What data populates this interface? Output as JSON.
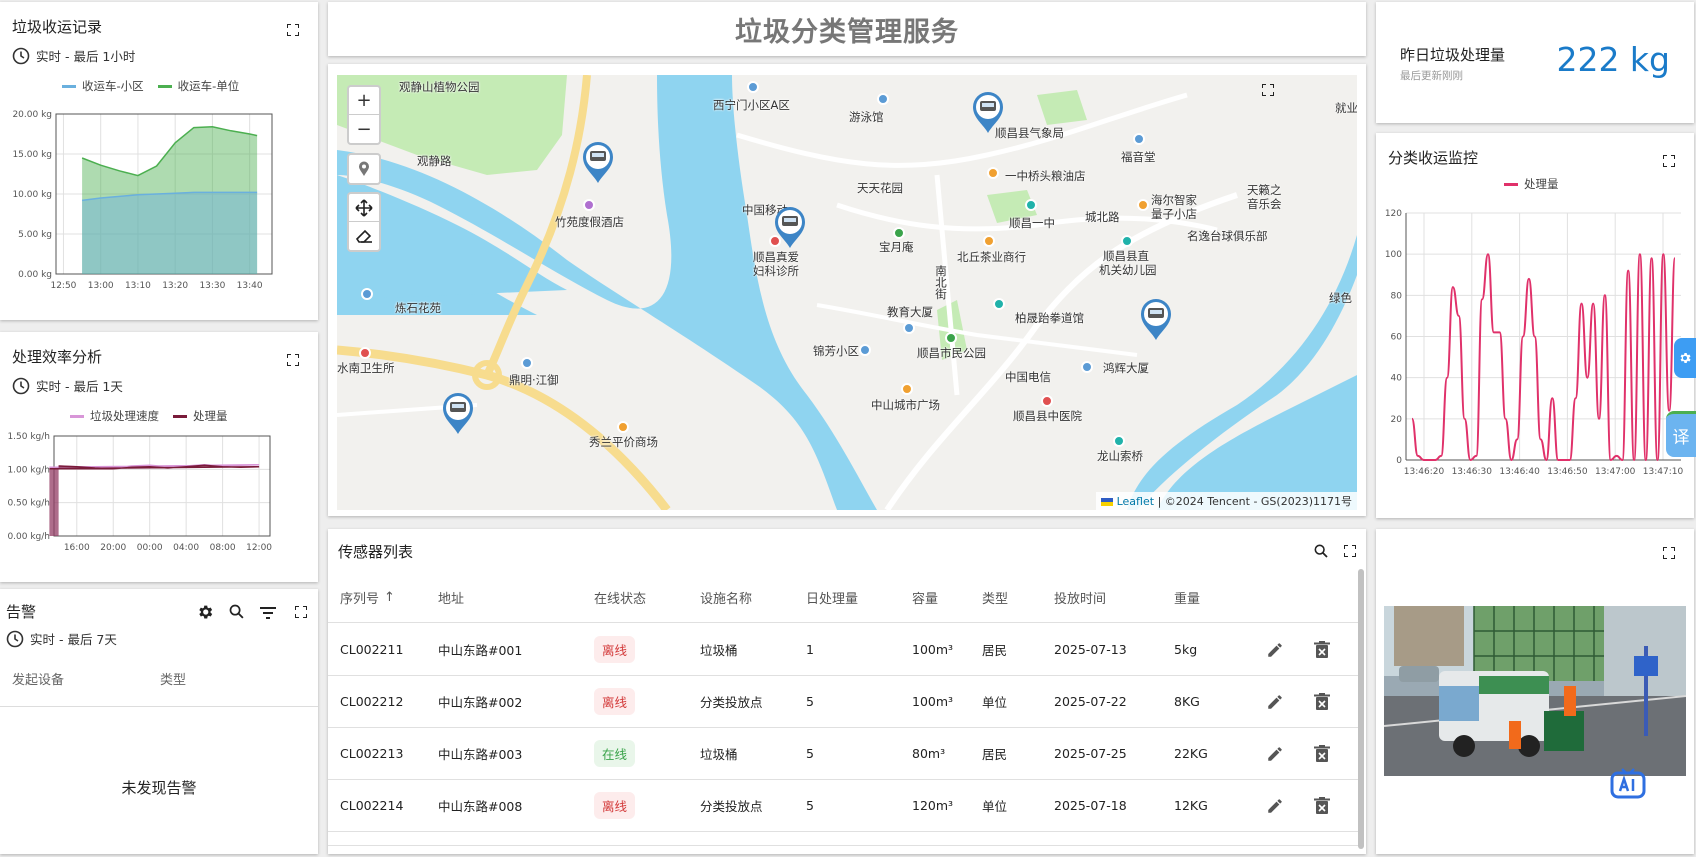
{
  "header": {
    "title": "垃圾分类管理服务"
  },
  "collection": {
    "title": "垃圾收运记录",
    "subtitle": "实时 - 最后 1小时",
    "chart_data": {
      "type": "area",
      "series": [
        {
          "name": "收运车-小区",
          "color": "#6ab0de",
          "x": [
            "12:55",
            "13:00",
            "13:05",
            "13:10",
            "13:15",
            "13:20",
            "13:25",
            "13:30",
            "13:35",
            "13:40",
            "13:42"
          ],
          "values": [
            9.2,
            9.5,
            9.7,
            9.9,
            10.0,
            10.1,
            10.2,
            10.2,
            10.2,
            10.2,
            10.2
          ]
        },
        {
          "name": "收运车-单位",
          "color": "#4caf50",
          "x": [
            "12:55",
            "13:00",
            "13:05",
            "13:10",
            "13:15",
            "13:20",
            "13:25",
            "13:30",
            "13:35",
            "13:40",
            "13:42"
          ],
          "values": [
            14.5,
            13.6,
            12.9,
            12.3,
            13.5,
            16.4,
            18.3,
            18.4,
            17.9,
            17.5,
            17.3
          ]
        }
      ],
      "x_ticks": [
        "12:50",
        "13:00",
        "13:10",
        "13:20",
        "13:30",
        "13:40"
      ],
      "y_ticks": [
        "0.00 kg",
        "5.00 kg",
        "10.00 kg",
        "15.00 kg",
        "20.00 kg"
      ],
      "ylim": [
        0,
        20
      ]
    }
  },
  "efficiency": {
    "title": "处理效率分析",
    "subtitle": "实时 - 最后 1天",
    "chart_data": {
      "type": "area",
      "series": [
        {
          "name": "垃圾处理速度",
          "color": "#d896d8",
          "x": [
            "14:00",
            "16:00",
            "18:00",
            "20:00",
            "22:00",
            "00:00",
            "02:00",
            "04:00",
            "06:00",
            "08:00",
            "10:00",
            "12:00",
            "13:00"
          ],
          "values": [
            1.05,
            1.04,
            1.03,
            1.02,
            1.05,
            1.06,
            1.04,
            1.05,
            1.07,
            1.05,
            1.06,
            1.07,
            1.03
          ]
        },
        {
          "name": "处理量",
          "color": "#7a1b3a",
          "x": [
            "14:00",
            "16:00",
            "18:00",
            "20:00",
            "22:00",
            "00:00",
            "02:00",
            "04:00",
            "06:00",
            "08:00",
            "10:00",
            "12:00",
            "13:00"
          ],
          "values": [
            1.05,
            1.04,
            1.02,
            1.01,
            1.03,
            1.04,
            1.02,
            1.04,
            1.06,
            1.04,
            1.03,
            1.04,
            1.01
          ]
        }
      ],
      "x_ticks": [
        "16:00",
        "20:00",
        "00:00",
        "04:00",
        "08:00",
        "12:00"
      ],
      "y_ticks": [
        "0.00 kg/h",
        "0.50 kg/h",
        "1.00 kg/h",
        "1.50 kg/h"
      ],
      "ylim": [
        0,
        1.5
      ]
    }
  },
  "alerts": {
    "title": "告警",
    "subtitle": "实时 - 最后 7天",
    "columns": [
      "发起设备",
      "类型"
    ],
    "empty": "未发现告警"
  },
  "map": {
    "attribution_leaflet": "Leaflet",
    "attribution_rest": "| ©2024 Tencent - GS(2023)1171号",
    "labels": [
      {
        "text": "观静山植物公园"
      },
      {
        "text": "西宁门小区A区"
      },
      {
        "text": "游泳馆"
      },
      {
        "text": "顺昌县气象局"
      },
      {
        "text": "福音堂"
      },
      {
        "text": "观静路"
      },
      {
        "text": "一中桥头粮油店"
      },
      {
        "text": "天天花园"
      },
      {
        "text": "竹苑度假酒店"
      },
      {
        "text": "中国移动"
      },
      {
        "text": "顺昌一中"
      },
      {
        "text": "城北路"
      },
      {
        "text": "海尔智家"
      },
      {
        "text": "量子小店"
      },
      {
        "text": "天籁之"
      },
      {
        "text": "音乐会"
      },
      {
        "text": "名逸台球俱乐部"
      },
      {
        "text": "宝月庵"
      },
      {
        "text": "顺昌真爱"
      },
      {
        "text": "妇科诊所"
      },
      {
        "text": "北丘茶业商行"
      },
      {
        "text": "顺昌县直"
      },
      {
        "text": "机关幼儿园"
      },
      {
        "text": "炼石花苑"
      },
      {
        "text": "教育大厦"
      },
      {
        "text": "柏晟跆拳道馆"
      },
      {
        "text": "南北街"
      },
      {
        "text": "锦芳小区"
      },
      {
        "text": "顺昌市民公园"
      },
      {
        "text": "水南卫生所"
      },
      {
        "text": "鼎明·江御"
      },
      {
        "text": "中国电信"
      },
      {
        "text": "鸿辉大厦"
      },
      {
        "text": "中山城市广场"
      },
      {
        "text": "顺昌县中医院"
      },
      {
        "text": "秀兰平价商场"
      },
      {
        "text": "龙山索桥"
      },
      {
        "text": "绿色"
      },
      {
        "text": "就业"
      }
    ]
  },
  "sensors": {
    "title": "传感器列表",
    "columns": [
      "序列号",
      "地址",
      "在线状态",
      "设施名称",
      "日处理量",
      "容量",
      "类型",
      "投放时间",
      "重量"
    ],
    "rows": [
      {
        "id": "CL002211",
        "addr": "中山东路#001",
        "status": "离线",
        "status_kind": "off",
        "name": "垃圾桶",
        "daily": "1",
        "cap": "100m³",
        "type": "居民",
        "date": "2025-07-13",
        "weight": "5kg"
      },
      {
        "id": "CL002212",
        "addr": "中山东路#002",
        "status": "离线",
        "status_kind": "off",
        "name": "分类投放点",
        "daily": "5",
        "cap": "100m³",
        "type": "单位",
        "date": "2025-07-22",
        "weight": "8KG"
      },
      {
        "id": "CL002213",
        "addr": "中山东路#003",
        "status": "在线",
        "status_kind": "on",
        "name": "垃圾桶",
        "daily": "5",
        "cap": "80m³",
        "type": "居民",
        "date": "2025-07-25",
        "weight": "22KG"
      },
      {
        "id": "CL002214",
        "addr": "中山东路#008",
        "status": "离线",
        "status_kind": "off",
        "name": "分类投放点",
        "daily": "5",
        "cap": "120m³",
        "type": "单位",
        "date": "2025-07-18",
        "weight": "12KG"
      }
    ]
  },
  "stat": {
    "label": "昨日垃圾处理量",
    "sub": "最后更新刚刚",
    "value": "222 kg"
  },
  "watch": {
    "title": "分类收运监控",
    "legend": "处理量",
    "chart_data": {
      "type": "line",
      "series": [
        {
          "name": "处理量",
          "color": "#e0316a",
          "values": [
            20,
            2,
            0,
            0,
            0,
            2,
            40,
            84,
            70,
            20,
            0,
            2,
            78,
            100,
            62,
            62,
            20,
            0,
            10,
            60,
            88,
            60,
            10,
            0,
            30,
            0,
            0,
            0,
            30,
            76,
            40,
            76,
            20,
            80,
            0,
            2,
            0,
            92,
            0,
            100,
            0,
            98,
            0,
            100,
            24,
            98
          ]
        }
      ],
      "x_ticks": [
        "13:46:20",
        "13:46:30",
        "13:46:40",
        "13:46:50",
        "13:47:00",
        "13:47:10"
      ],
      "y_ticks": [
        "0",
        "20",
        "40",
        "60",
        "80",
        "100",
        "120"
      ],
      "ylim": [
        0,
        120
      ]
    }
  },
  "side": {
    "translate": "译"
  }
}
